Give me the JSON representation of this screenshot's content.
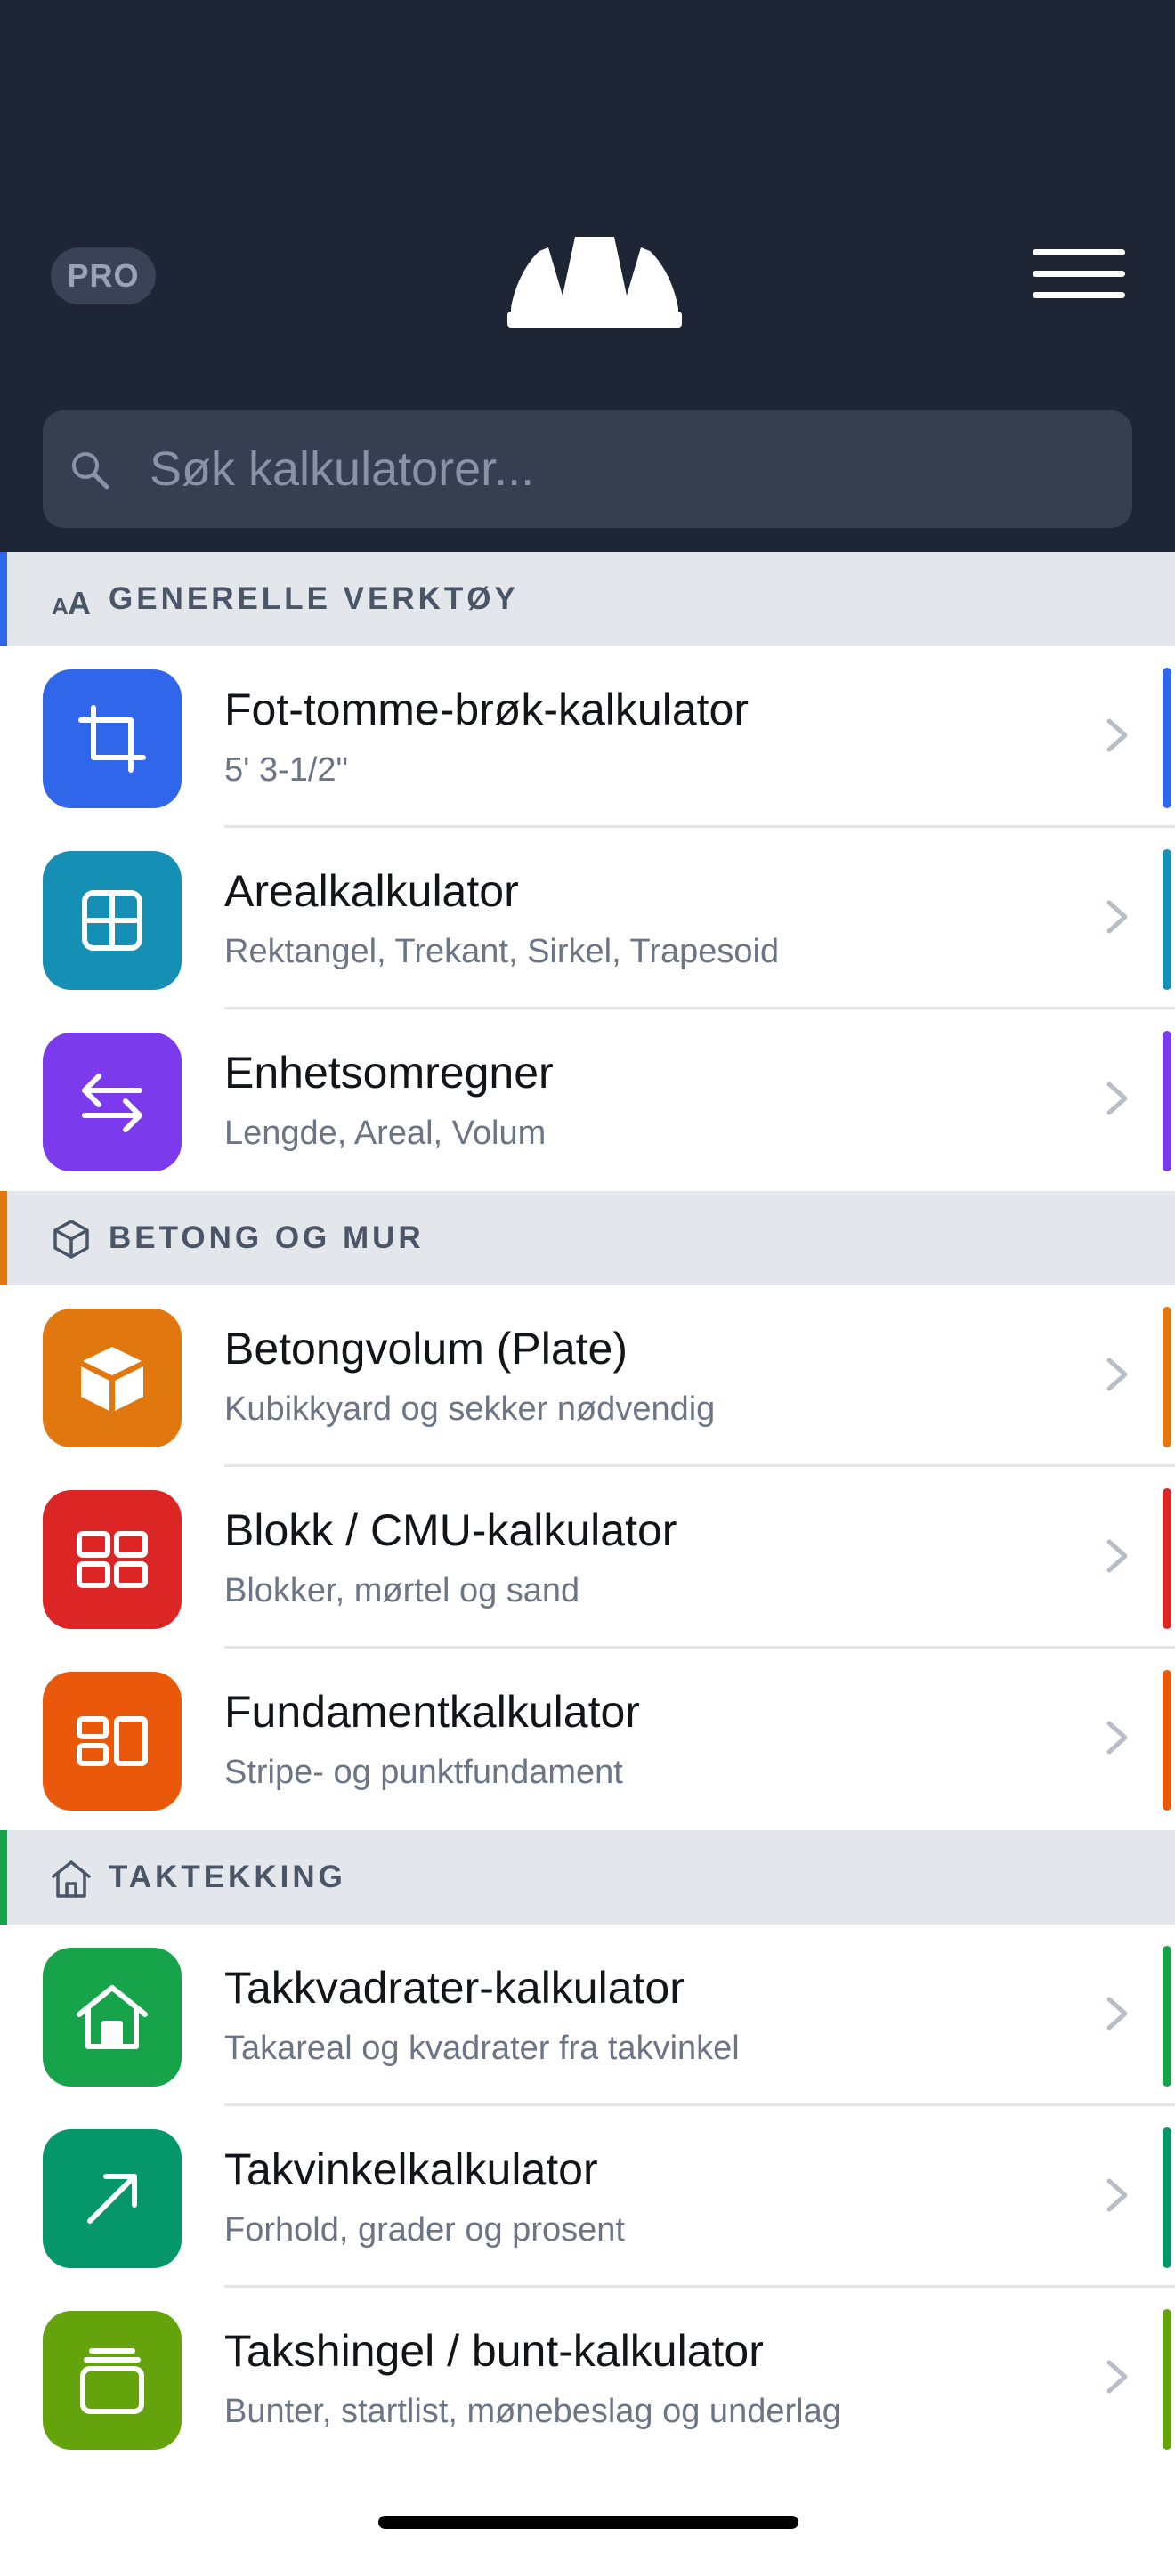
{
  "header": {
    "pro_label": "PRO",
    "logo_icon": "hard-hat-icon",
    "menu_icon": "hamburger-menu-icon"
  },
  "search": {
    "placeholder": "Søk kalkulatorer...",
    "value": ""
  },
  "sections": [
    {
      "title": "GENERELLE VERKTØY",
      "icon": "text-size-icon",
      "accent": "#2f66ea",
      "items": [
        {
          "title": "Fot-tomme-brøk-kalkulator",
          "subtitle": "5' 3-1/2\"",
          "icon": "crop-icon",
          "color": "#2f66ea"
        },
        {
          "title": "Arealkalkulator",
          "subtitle": "Rektangel, Trekant, Sirkel, Trapesoid",
          "icon": "grid-icon",
          "color": "#1590b4"
        },
        {
          "title": "Enhetsomregner",
          "subtitle": "Lengde, Areal, Volum",
          "icon": "swap-arrows-icon",
          "color": "#7c3aed"
        }
      ]
    },
    {
      "title": "BETONG OG MUR",
      "icon": "cube-icon",
      "accent": "#e0780f",
      "items": [
        {
          "title": "Betongvolum (Plate)",
          "subtitle": "Kubikkyard og sekker nødvendig",
          "icon": "box-icon",
          "color": "#e0780f"
        },
        {
          "title": "Blokk / CMU-kalkulator",
          "subtitle": "Blokker, mørtel og sand",
          "icon": "blocks-icon",
          "color": "#dc2626"
        },
        {
          "title": "Fundamentkalkulator",
          "subtitle": "Stripe- og punktfundament",
          "icon": "foundation-icon",
          "color": "#ea580c"
        }
      ]
    },
    {
      "title": "TAKTEKKING",
      "icon": "house-outline-icon",
      "accent": "#16a34a",
      "items": [
        {
          "title": "Takkvadrater-kalkulator",
          "subtitle": "Takareal og kvadrater fra takvinkel",
          "icon": "house-icon",
          "color": "#16a34a"
        },
        {
          "title": "Takvinkelkalkulator",
          "subtitle": "Forhold, grader og prosent",
          "icon": "arrow-up-right-icon",
          "color": "#059669"
        },
        {
          "title": "Takshingel / bunt-kalkulator",
          "subtitle": "Bunter, startlist, mønebeslag og underlag",
          "icon": "stack-icon",
          "color": "#65a30d"
        }
      ]
    }
  ]
}
